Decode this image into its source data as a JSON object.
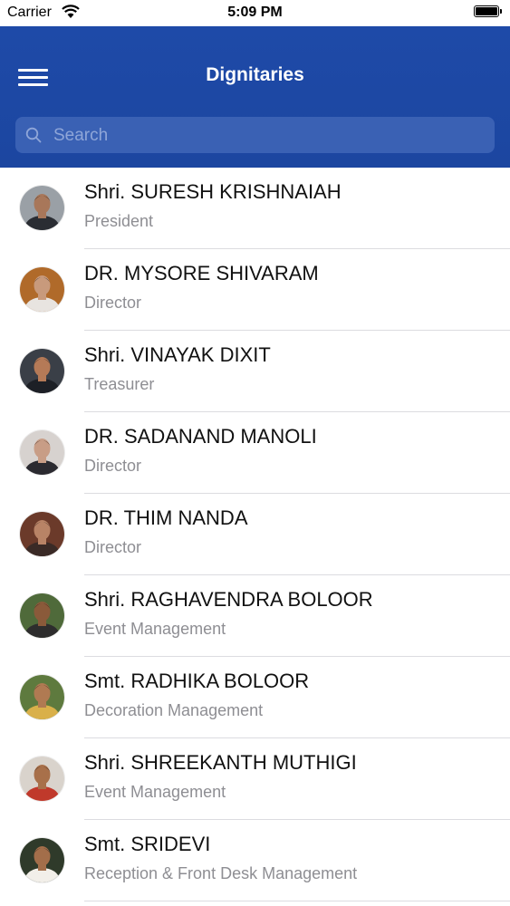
{
  "status_bar": {
    "carrier": "Carrier",
    "time": "5:09 PM"
  },
  "header": {
    "title": "Dignitaries"
  },
  "search": {
    "placeholder": "Search"
  },
  "people": [
    {
      "name": "Shri. SURESH KRISHNAIAH",
      "role": "President",
      "bg": "#9aa0a6",
      "skin": "#a8775a",
      "shirt": "#2a2d33"
    },
    {
      "name": "DR. MYSORE SHIVARAM",
      "role": "Director",
      "bg": "#b06a2a",
      "skin": "#c89a7c",
      "shirt": "#e8e4e0"
    },
    {
      "name": "Shri. VINAYAK DIXIT",
      "role": "Treasurer",
      "bg": "#3a3f47",
      "skin": "#b57a57",
      "shirt": "#1d2026"
    },
    {
      "name": "DR. SADANAND MANOLI",
      "role": "Director",
      "bg": "#d7d2cf",
      "skin": "#c89d86",
      "shirt": "#2b2a30"
    },
    {
      "name": "DR. THIM NANDA",
      "role": "Director",
      "bg": "#6b3a2a",
      "skin": "#b88366",
      "shirt": "#3a2a26"
    },
    {
      "name": "Shri. RAGHAVENDRA BOLOOR",
      "role": "Event Management",
      "bg": "#4f6a3a",
      "skin": "#8a5a3a",
      "shirt": "#2d2d2d"
    },
    {
      "name": "Smt. RADHIKA BOLOOR",
      "role": "Decoration Management",
      "bg": "#5e7a3e",
      "skin": "#b07a52",
      "shirt": "#d9b04a"
    },
    {
      "name": "Shri. SHREEKANTH MUTHIGI",
      "role": "Event Management",
      "bg": "#d9d3cc",
      "skin": "#a8704a",
      "shirt": "#c0392b"
    },
    {
      "name": "Smt. SRIDEVI",
      "role": "Reception & Front Desk Management",
      "bg": "#2f3a2a",
      "skin": "#a36e4a",
      "shirt": "#f2efe9"
    }
  ]
}
